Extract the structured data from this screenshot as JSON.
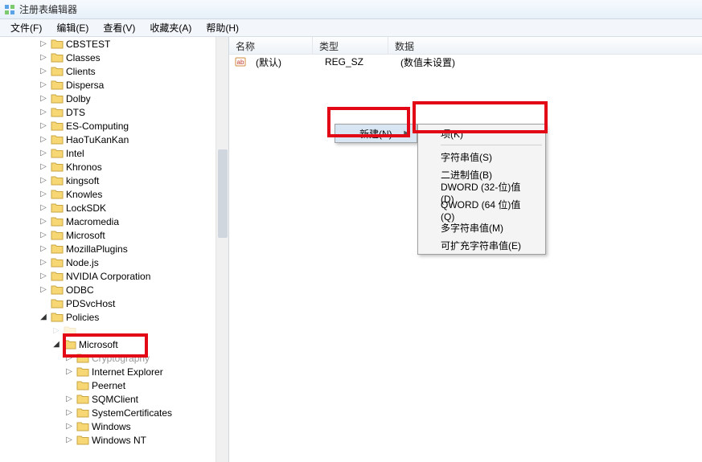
{
  "window": {
    "title": "注册表编辑器"
  },
  "menubar": {
    "items": [
      "文件(F)",
      "编辑(E)",
      "查看(V)",
      "收藏夹(A)",
      "帮助(H)"
    ]
  },
  "columns": {
    "name": "名称",
    "type": "类型",
    "data": "数据",
    "w_name": 104,
    "w_type": 94
  },
  "row": {
    "name": "(默认)",
    "type": "REG_SZ",
    "data": "(数值未设置)"
  },
  "context": {
    "new_label": "新建(N)"
  },
  "submenu": {
    "items": [
      "项(K)",
      "字符串值(S)",
      "二进制值(B)",
      "DWORD (32-位)值(D)",
      "QWORD (64 位)值(Q)",
      "多字符串值(M)",
      "可扩充字符串值(E)"
    ]
  },
  "tree": {
    "items": [
      {
        "l": "CBSTEST",
        "d": 3,
        "e": "closed"
      },
      {
        "l": "Classes",
        "d": 3,
        "e": "closed"
      },
      {
        "l": "Clients",
        "d": 3,
        "e": "closed"
      },
      {
        "l": "Dispersa",
        "d": 3,
        "e": "closed"
      },
      {
        "l": "Dolby",
        "d": 3,
        "e": "closed"
      },
      {
        "l": "DTS",
        "d": 3,
        "e": "closed"
      },
      {
        "l": "ES-Computing",
        "d": 3,
        "e": "closed"
      },
      {
        "l": "HaoTuKanKan",
        "d": 3,
        "e": "closed"
      },
      {
        "l": "Intel",
        "d": 3,
        "e": "closed"
      },
      {
        "l": "Khronos",
        "d": 3,
        "e": "closed"
      },
      {
        "l": "kingsoft",
        "d": 3,
        "e": "closed"
      },
      {
        "l": "Knowles",
        "d": 3,
        "e": "closed"
      },
      {
        "l": "LockSDK",
        "d": 3,
        "e": "closed"
      },
      {
        "l": "Macromedia",
        "d": 3,
        "e": "closed"
      },
      {
        "l": "Microsoft",
        "d": 3,
        "e": "closed"
      },
      {
        "l": "MozillaPlugins",
        "d": 3,
        "e": "closed"
      },
      {
        "l": "Node.js",
        "d": 3,
        "e": "closed"
      },
      {
        "l": "NVIDIA Corporation",
        "d": 3,
        "e": "closed"
      },
      {
        "l": "ODBC",
        "d": 3,
        "e": "closed"
      },
      {
        "l": "PDSvcHost",
        "d": 3,
        "e": "none"
      },
      {
        "l": "Policies",
        "d": 3,
        "e": "open"
      },
      {
        "l": "",
        "d": 4,
        "e": "closed",
        "ghost": true
      },
      {
        "l": "Microsoft",
        "d": 4,
        "e": "open",
        "hl": true
      },
      {
        "l": "Cryptography",
        "d": 5,
        "e": "closed",
        "dim": true
      },
      {
        "l": "Internet Explorer",
        "d": 5,
        "e": "closed"
      },
      {
        "l": "Peernet",
        "d": 5,
        "e": "none"
      },
      {
        "l": "SQMClient",
        "d": 5,
        "e": "closed"
      },
      {
        "l": "SystemCertificates",
        "d": 5,
        "e": "closed"
      },
      {
        "l": "Windows",
        "d": 5,
        "e": "closed"
      },
      {
        "l": "Windows NT",
        "d": 5,
        "e": "closed"
      }
    ]
  }
}
